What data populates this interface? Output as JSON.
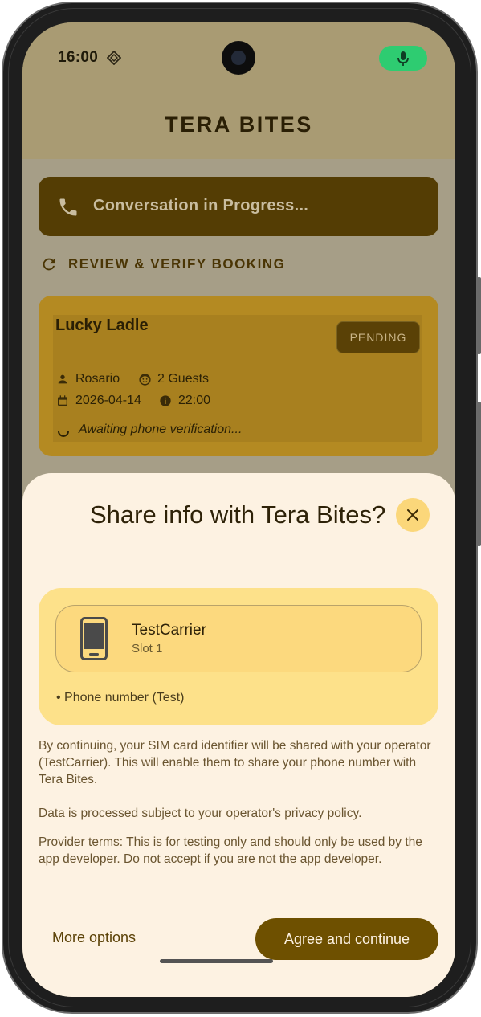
{
  "status_bar": {
    "time": "16:00",
    "status_icon": "sync-diamond-icon",
    "mic_indicator": "microphone-icon"
  },
  "app": {
    "title": "TERA BITES"
  },
  "banner": {
    "icon": "phone-icon",
    "text": "Conversation in Progress..."
  },
  "review": {
    "icon": "refresh-icon",
    "label": "REVIEW & VERIFY BOOKING"
  },
  "booking": {
    "restaurant": "Lucky Ladle",
    "status": "PENDING",
    "name": "Rosario",
    "guests": "2 Guests",
    "date": "2026-04-14",
    "time": "22:00",
    "awaiting": "Awaiting phone verification..."
  },
  "sheet": {
    "title": "Share info with Tera Bites?",
    "close_icon": "close-icon",
    "carrier": {
      "name": "TestCarrier",
      "slot": "Slot 1",
      "icon": "phone-device-icon"
    },
    "shared_item": "• Phone number (Test)",
    "paragraph1": "By continuing, your SIM card identifier will be shared with your operator (TestCarrier). This will enable them to share your phone number with Tera Bites.",
    "paragraph2": "Data is processed subject to your operator's privacy policy.",
    "paragraph3": "Provider terms: This is for testing only and should only be used by the app developer. Do not accept if you are not the app developer.",
    "more_options": "More options",
    "agree": "Agree and continue"
  },
  "colors": {
    "sheet_bg": "#fdf2e2",
    "accent_button": "#6e5000",
    "banner": "#543d04",
    "card": "#b48a22",
    "info_panel": "#fde18a",
    "mic_pill": "#2ecc71"
  }
}
